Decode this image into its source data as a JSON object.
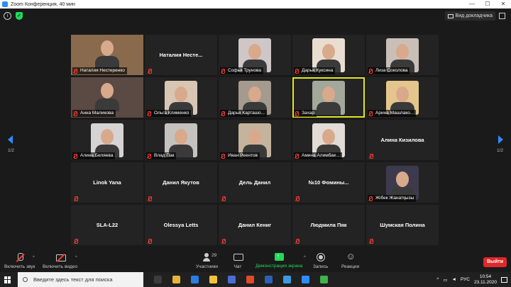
{
  "window": {
    "title": "Zoom Конференция, 40 мин",
    "minimize": "—",
    "maximize": "☐",
    "close": "✕"
  },
  "top": {
    "view_label": "Вид докладчика"
  },
  "page": {
    "left": "1/2",
    "right": "1/2"
  },
  "tiles": [
    {
      "name": "Наталия Нестеренко",
      "type": "video",
      "bg": "#8a6a4c"
    },
    {
      "name": "Наталия  Несте...",
      "type": "name"
    },
    {
      "name": "Софья Трунова",
      "type": "video",
      "bg": "#cfc6c8"
    },
    {
      "name": "Дарья Куксина",
      "type": "video",
      "bg": "#e8ddd0"
    },
    {
      "name": "Лиза Соколова",
      "type": "video",
      "bg": "#c9bfb8"
    },
    {
      "name": "Анна Маликова",
      "type": "video",
      "bg": "#5a4a43"
    },
    {
      "name": "Ольга Клименко",
      "type": "video",
      "bg": "#d8c6b4"
    },
    {
      "name": "Дарья Карташо...",
      "type": "video",
      "bg": "#a49a8e"
    },
    {
      "name": "Захар",
      "type": "video",
      "bg": "#a2a89a",
      "active": true
    },
    {
      "name": "Арина Машлако...",
      "type": "video",
      "bg": "#e4c68c"
    },
    {
      "name": "Алина Беляева",
      "type": "video",
      "bg": "#d6d3d4"
    },
    {
      "name": "Влад Пак",
      "type": "video",
      "bg": "#c5c3c0"
    },
    {
      "name": "Иван Реентов",
      "type": "video",
      "bg": "#c4b49e"
    },
    {
      "name": "Амина Алимбае...",
      "type": "video",
      "bg": "#e2dcd6"
    },
    {
      "name": "Алина Кизилова",
      "type": "name"
    },
    {
      "name": "Linok Yana",
      "type": "name"
    },
    {
      "name": "Данил Якутов",
      "type": "name"
    },
    {
      "name": "Дель Данил",
      "type": "name"
    },
    {
      "name": "№10  Фомины...",
      "type": "name"
    },
    {
      "name": "Жібек Жанатқызы",
      "type": "video",
      "bg": "#3e3a4e"
    },
    {
      "name": "SLA-L22",
      "type": "name"
    },
    {
      "name": "Olessya Letts",
      "type": "name"
    },
    {
      "name": "Данил Кениг",
      "type": "name"
    },
    {
      "name": "Людмила Пяк",
      "type": "name"
    },
    {
      "name": "Шумская Полина",
      "type": "name"
    }
  ],
  "toolbar": {
    "audio": "Включить звук",
    "video": "Включить видео",
    "participants": "Участники",
    "participants_count": "29",
    "chat": "Чат",
    "share": "Демонстрация экрана",
    "record": "Запись",
    "reactions": "Реакции",
    "leave": "Выйти"
  },
  "taskbar": {
    "search_placeholder": "Введите здесь текст для поиска",
    "lang": "РУС",
    "time": "10:54",
    "date": "23.11.2020",
    "apps": [
      "#3c3c3c",
      "#e8b33b",
      "#2b7de0",
      "#f0c33b",
      "#4b6bd6",
      "#e04a2a",
      "#2b5fb8",
      "#3c9ae0",
      "#2d8cff",
      "#3fb24a"
    ]
  },
  "colors": {
    "accent": "#2d8cff",
    "leave": "#e02828",
    "share": "#23d959",
    "active_speaker": "#e2e624"
  }
}
